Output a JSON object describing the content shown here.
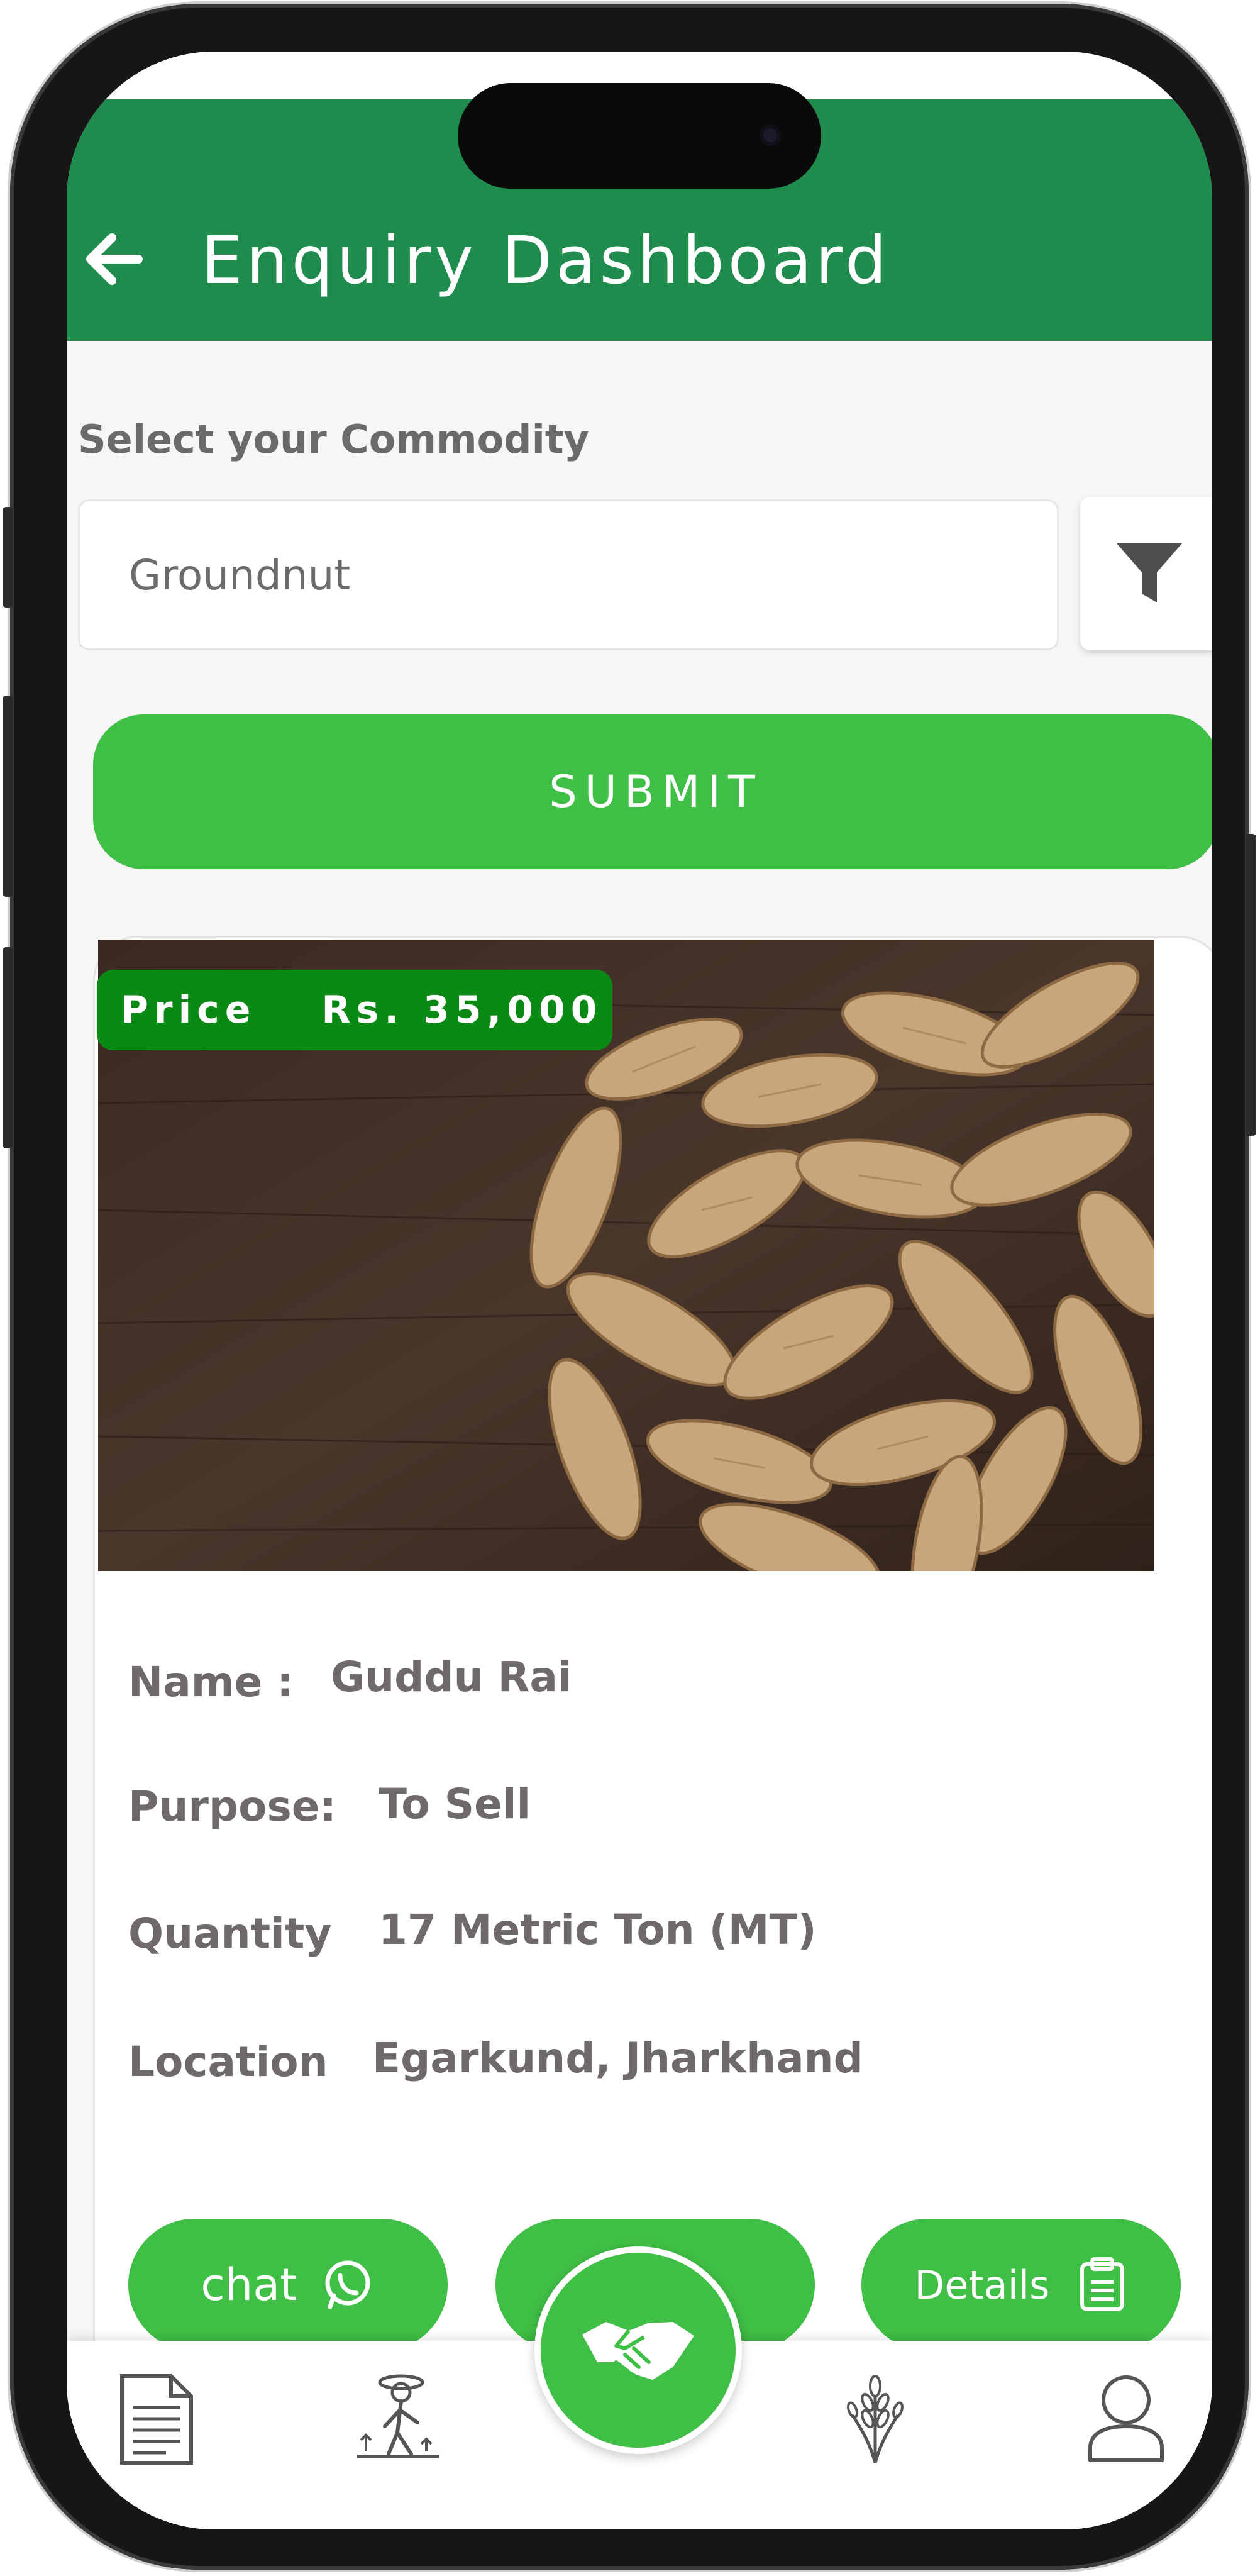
{
  "header": {
    "title": "Enquiry Dashboard"
  },
  "filter": {
    "label": "Select your Commodity",
    "commodity_value": "Groundnut"
  },
  "submit_label": "SUBMIT",
  "listing": {
    "price_label": "Price",
    "price_value": "Rs. 35,000",
    "fields": [
      {
        "label": "Name :",
        "value": "Guddu Rai"
      },
      {
        "label": "Purpose:",
        "value": "To Sell"
      },
      {
        "label": "Quantity",
        "value": "17 Metric Ton (MT)"
      },
      {
        "label": "Location",
        "value": "Egarkund, Jharkhand"
      }
    ]
  },
  "actions": {
    "chat_label": "chat",
    "details_label": "Details"
  },
  "nav": {
    "icons": [
      "document-icon",
      "farmer-icon",
      "handshake-icon",
      "wheat-icon",
      "profile-icon"
    ]
  },
  "colors": {
    "header_green": "#1f8c4e",
    "accent_green": "#3fbf45",
    "badge_green": "#0a8a14"
  }
}
